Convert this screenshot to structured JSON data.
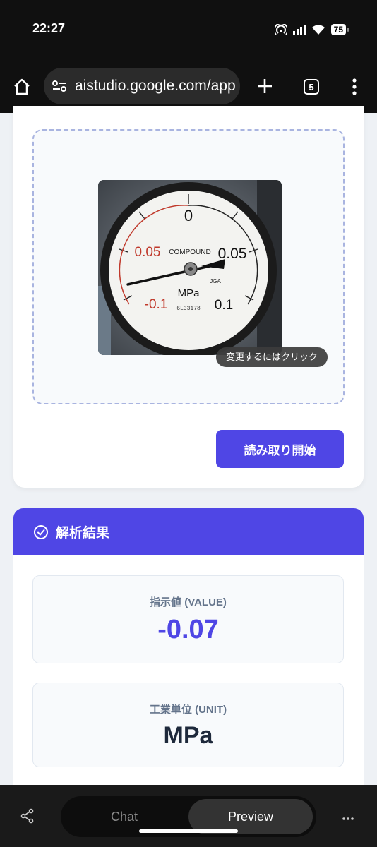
{
  "status_bar": {
    "time": "22:27",
    "battery": "75"
  },
  "browser": {
    "url": "aistudio.google.com/app",
    "tab_count": "5",
    "icons": [
      "home-icon",
      "site-settings-icon",
      "new-tab-icon",
      "tabs-icon",
      "more-vert-icon"
    ]
  },
  "upload": {
    "tooltip": "変更するにはクリック",
    "start_button": "読み取り開始"
  },
  "gauge_photo": {
    "top_label": "0",
    "left_label": "0.05",
    "right_label": "0.05",
    "bottom_left_label": "-0.1",
    "bottom_right_label": "0.1",
    "compound": "COMPOUND",
    "unit": "MPa",
    "serial": "6L33178",
    "jga": "JGA"
  },
  "results": {
    "title": "解析結果",
    "value_label": "指示値 (VALUE)",
    "value": "-0.07",
    "unit_label": "工業単位 (UNIT)",
    "unit": "MPa"
  },
  "bottom_bar": {
    "chat": "Chat",
    "preview": "Preview",
    "active_tab": "Preview"
  },
  "colors": {
    "accent": "#4f46e5",
    "value_text": "#4f46e5",
    "unit_text": "#1e293b"
  }
}
